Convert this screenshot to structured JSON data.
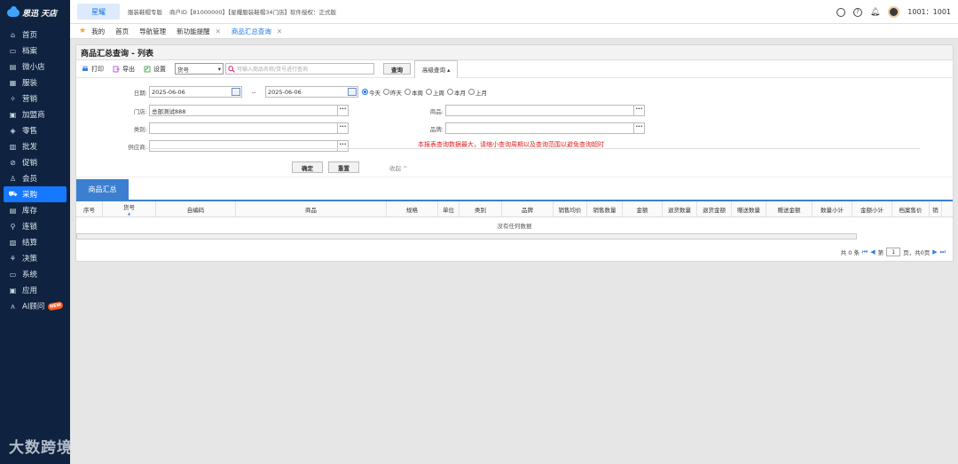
{
  "app": {
    "logo_text": "思迅 天店"
  },
  "sidebar": {
    "items": [
      {
        "label": "首页",
        "icon": "home-icon",
        "glyph": "⌂",
        "active": false
      },
      {
        "label": "档案",
        "icon": "folder-icon",
        "glyph": "▭",
        "active": false
      },
      {
        "label": "微小店",
        "icon": "store-icon",
        "glyph": "▤",
        "active": false
      },
      {
        "label": "服装",
        "icon": "clothing-icon",
        "glyph": "▦",
        "active": false
      },
      {
        "label": "营销",
        "icon": "marketing-icon",
        "glyph": "✧",
        "active": false
      },
      {
        "label": "加盟商",
        "icon": "franchise-icon",
        "glyph": "▣",
        "active": false
      },
      {
        "label": "零售",
        "icon": "retail-icon",
        "glyph": "◈",
        "active": false
      },
      {
        "label": "批发",
        "icon": "wholesale-icon",
        "glyph": "▥",
        "active": false
      },
      {
        "label": "促销",
        "icon": "promotion-icon",
        "glyph": "⊘",
        "active": false
      },
      {
        "label": "会员",
        "icon": "member-icon",
        "glyph": "♙",
        "active": false
      },
      {
        "label": "采购",
        "icon": "cart-icon",
        "glyph": "⛟",
        "active": true
      },
      {
        "label": "库存",
        "icon": "inventory-icon",
        "glyph": "▤",
        "active": false
      },
      {
        "label": "连锁",
        "icon": "chain-icon",
        "glyph": "⚲",
        "active": false
      },
      {
        "label": "结算",
        "icon": "settlement-icon",
        "glyph": "▧",
        "active": false
      },
      {
        "label": "决策",
        "icon": "decision-icon",
        "glyph": "⚘",
        "active": false
      },
      {
        "label": "系统",
        "icon": "system-icon",
        "glyph": "▭",
        "active": false
      },
      {
        "label": "应用",
        "icon": "apps-icon",
        "glyph": "▣",
        "active": false
      },
      {
        "label": "AI顾问",
        "icon": "ai-icon",
        "glyph": "ᴧ",
        "active": false,
        "badge": "NEW"
      }
    ],
    "watermark": "大数跨境"
  },
  "topbar": {
    "brand": "星耀",
    "edition": "服装鞋帽专版",
    "merchant": "商户ID【81000000】【星耀服装鞋帽34门店】软件授权：正式版",
    "user": "1001：1001"
  },
  "tabs": [
    {
      "label": "我的",
      "star": true,
      "closable": false,
      "active": false
    },
    {
      "label": "首页",
      "closable": false,
      "active": false
    },
    {
      "label": "导航管理",
      "closable": false,
      "active": false
    },
    {
      "label": "新功能提醒",
      "closable": true,
      "active": false
    },
    {
      "label": "商品汇总查询",
      "closable": true,
      "active": true
    }
  ],
  "panel": {
    "title": "商品汇总查询 - 列表",
    "toolbar": {
      "print": "打印",
      "export": "导出",
      "settings": "设置",
      "field_select": "货号",
      "search_placeholder": "可输入商品名称/货号进行查询",
      "query": "查询",
      "advanced": "高级查询 ▴"
    },
    "form": {
      "date_label": "日期:",
      "date_from": "2025-06-06",
      "date_sep": "--",
      "date_to": "2025-06-06",
      "ranges": [
        "今天",
        "昨天",
        "本周",
        "上周",
        "本月",
        "上月"
      ],
      "store_label": "门店:",
      "store_value": "总部测试888",
      "goods_label": "商品:",
      "category_label": "类别:",
      "brand_label": "品牌:",
      "supplier_label": "供应商:",
      "warning": "本报表查询数据最大，请缩小查询周期以及查询范围以避免查询超时",
      "confirm": "确定",
      "reset": "重置",
      "collapse": "收起 ^"
    },
    "subtab": "商品汇总",
    "columns": [
      "序号",
      "货号",
      "自编码",
      "商品",
      "规格",
      "单位",
      "类别",
      "品牌",
      "销售均价",
      "销售数量",
      "金额",
      "退货数量",
      "退货金额",
      "赠送数量",
      "赠送金额",
      "数量小计",
      "金额小计",
      "档案售价",
      "销"
    ],
    "empty_text": "没有任何数据",
    "pager": {
      "total": "共 0 条",
      "page_prefix": "第",
      "page_value": "1",
      "page_suffix": "页，共0页"
    }
  },
  "colors": {
    "sidebar_bg": "#0f2340",
    "accent": "#1677ff",
    "warning": "#e02020"
  }
}
